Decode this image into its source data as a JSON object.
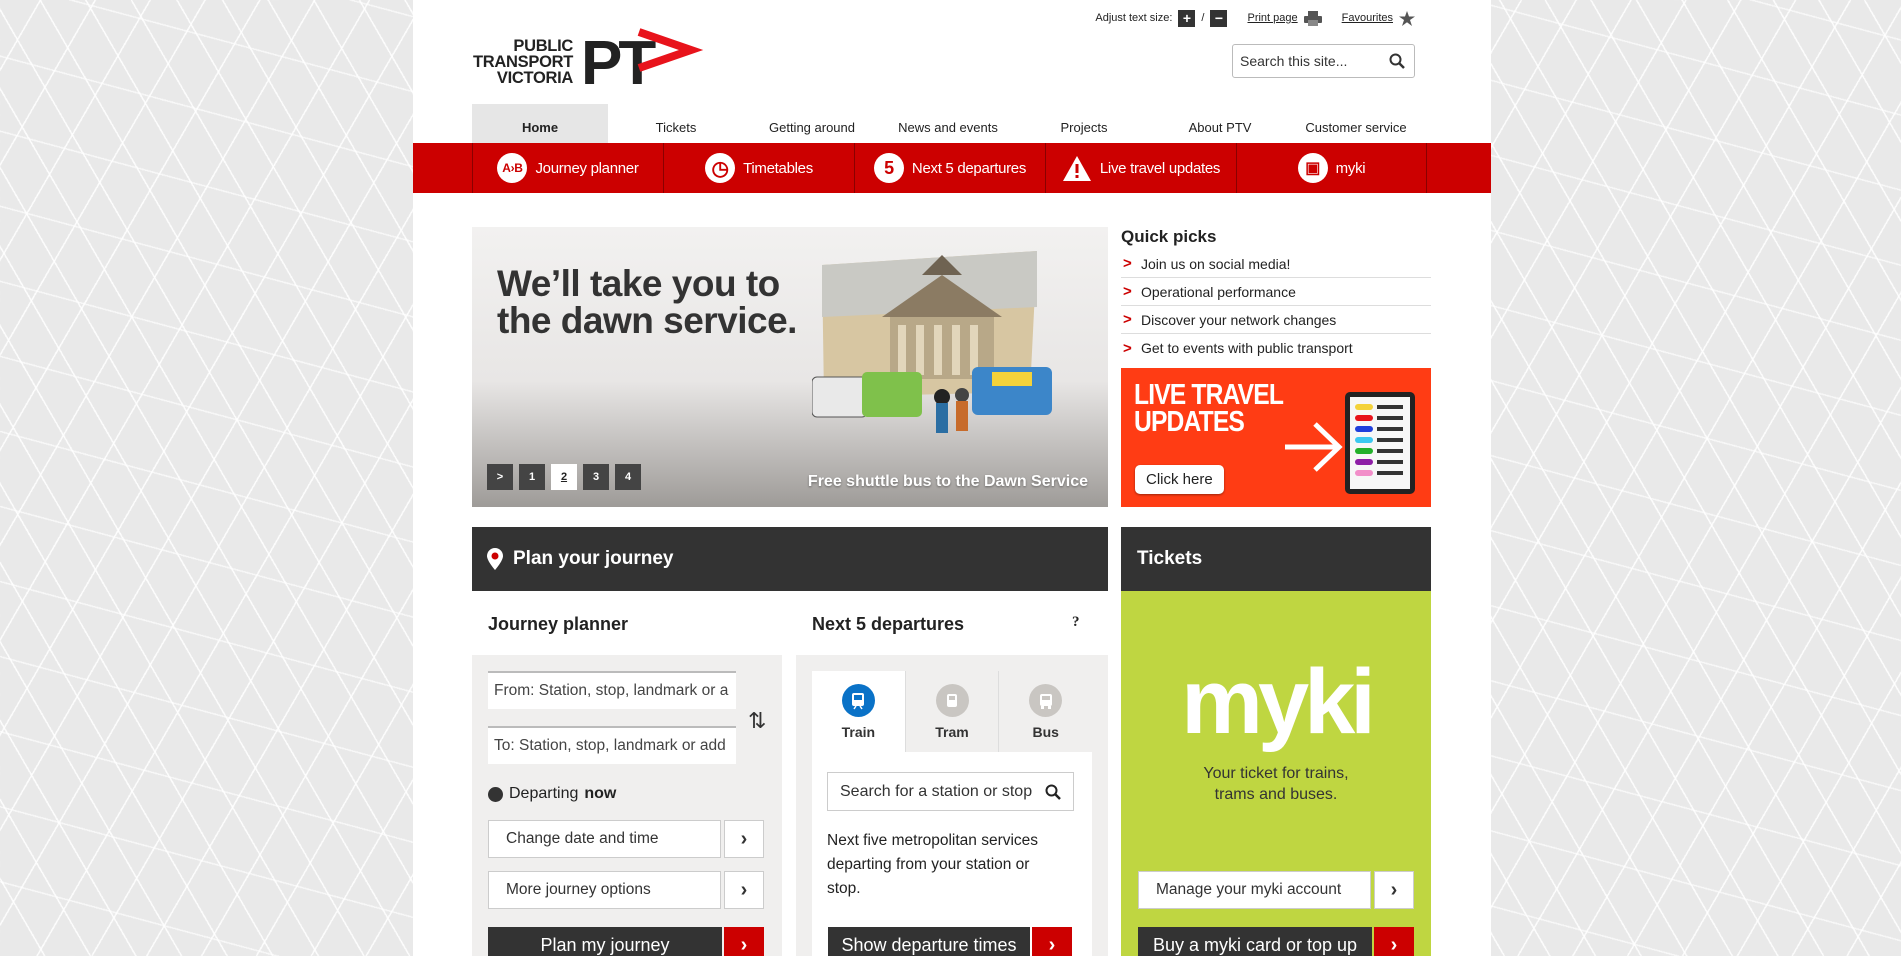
{
  "logo": {
    "line1": "PUBLIC",
    "line2": "TRANSPORT",
    "line3": "VICTORIA",
    "mark": "PT"
  },
  "util": {
    "text_size_label": "Adjust text size:",
    "plus": "+",
    "sep": "/",
    "minus": "−",
    "print": "Print page",
    "favourites": "Favourites"
  },
  "search": {
    "placeholder": "Search this site..."
  },
  "topnav": [
    "Home",
    "Tickets",
    "Getting around",
    "News and events",
    "Projects",
    "About PTV",
    "Customer service"
  ],
  "rednav": [
    {
      "label": "Journey planner",
      "icon": "A›B"
    },
    {
      "label": "Timetables",
      "icon": "◷"
    },
    {
      "label": "Next 5 departures",
      "icon": "5"
    },
    {
      "label": "Live travel updates",
      "icon": "!"
    },
    {
      "label": "myki",
      "icon": "▣"
    }
  ],
  "hero": {
    "headline": "We’ll take you to the dawn service.",
    "caption": "Free shuttle bus to the Dawn Service",
    "controls": [
      ">",
      "1",
      "2",
      "3",
      "4"
    ],
    "active_slide": "2"
  },
  "quick_picks": {
    "title": "Quick picks",
    "items": [
      "Join us on social media!",
      "Operational performance",
      "Discover your network changes",
      "Get to events with public transport"
    ]
  },
  "live_travel": {
    "title_line1": "LIVE TRAVEL",
    "title_line2": "UPDATES",
    "button": "Click here"
  },
  "plan": {
    "header": "Plan your journey",
    "journey_planner": {
      "title": "Journey planner",
      "from": "From: Station, stop, landmark or a",
      "to": "To: Station, stop, landmark or add",
      "departing": "Departing",
      "departing_when": "now",
      "change_date": "Change date and time",
      "more_options": "More journey options",
      "submit": "Plan my journey",
      "arrow": "›"
    },
    "next5": {
      "title": "Next 5 departures",
      "help": "?",
      "modes": [
        "Train",
        "Tram",
        "Bus"
      ],
      "search_placeholder": "Search for a station or stop",
      "description": "Next five metropolitan services departing from your station or stop.",
      "submit": "Show departure times"
    }
  },
  "tickets": {
    "header": "Tickets",
    "brand": "myki",
    "tagline_1": "Your ticket for trains,",
    "tagline_2": "trams and buses.",
    "manage": "Manage your myki account",
    "buy": "Buy a myki card or top up"
  },
  "colors": {
    "brand_red": "#cc0000",
    "dark": "#333333",
    "myki_green": "#bfd641",
    "live_orange": "#ff3c14"
  }
}
